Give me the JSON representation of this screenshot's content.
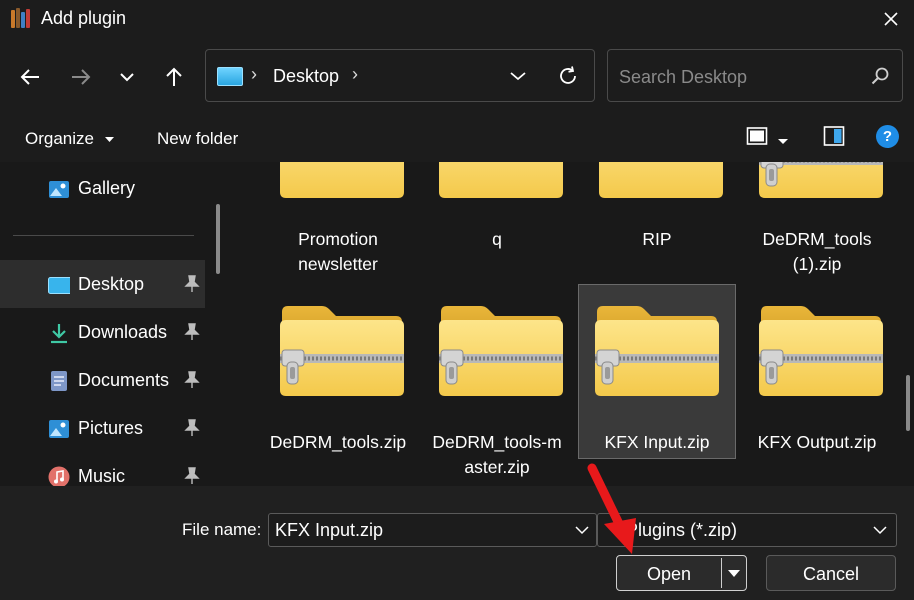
{
  "window": {
    "title": "Add plugin",
    "icons": {
      "app": "bookshelf-icon",
      "close": "close-icon"
    }
  },
  "navbar": {
    "icons": [
      "back-arrow-icon",
      "forward-arrow-icon",
      "recent-locations-chevron-icon",
      "up-arrow-icon"
    ],
    "address": {
      "folder_icon": "desktop-folder-icon",
      "separator": "›",
      "location": "Desktop",
      "trailing_separator": "›",
      "dropdown_icon": "chevron-down-icon",
      "refresh_icon": "refresh-icon"
    },
    "search": {
      "placeholder": "Search Desktop",
      "icon": "search-icon"
    }
  },
  "toolbar": {
    "organize_label": "Organize",
    "new_folder_label": "New folder",
    "view_icon": "view-mode-icon",
    "preview_icon": "preview-pane-icon",
    "help_label": "?"
  },
  "sidebar": {
    "items": [
      {
        "label": "Gallery",
        "icon": "gallery-icon",
        "pinned": false,
        "active": false
      },
      {
        "label": "Desktop",
        "icon": "desktop-folder-icon",
        "pinned": true,
        "active": true
      },
      {
        "label": "Downloads",
        "icon": "download-icon",
        "pinned": true,
        "active": false
      },
      {
        "label": "Documents",
        "icon": "documents-icon",
        "pinned": true,
        "active": false
      },
      {
        "label": "Pictures",
        "icon": "pictures-icon",
        "pinned": true,
        "active": false
      },
      {
        "label": "Music",
        "icon": "music-icon",
        "pinned": true,
        "active": false
      }
    ]
  },
  "files": {
    "row1": [
      {
        "name_line1": "Promotion",
        "name_line2": "newsletter",
        "type": "folder"
      },
      {
        "name_line1": "q",
        "name_line2": "",
        "type": "folder"
      },
      {
        "name_line1": "RIP",
        "name_line2": "",
        "type": "folder"
      },
      {
        "name_line1": "DeDRM_tools",
        "name_line2": "(1).zip",
        "type": "zip"
      }
    ],
    "row2": [
      {
        "name_line1": "DeDRM_tools.zip",
        "name_line2": "",
        "type": "zip",
        "selected": false
      },
      {
        "name_line1": "DeDRM_tools-m",
        "name_line2": "aster.zip",
        "type": "zip",
        "selected": false
      },
      {
        "name_line1": "KFX Input.zip",
        "name_line2": "",
        "type": "zip",
        "selected": true
      },
      {
        "name_line1": "KFX Output.zip",
        "name_line2": "",
        "type": "zip",
        "selected": false
      }
    ]
  },
  "bottom": {
    "file_name_label": "File name:",
    "file_name_value": "KFX Input.zip",
    "file_type_value": "Plugins (*.zip)",
    "open_label": "Open",
    "cancel_label": "Cancel"
  },
  "annotation": {
    "arrow_color": "#e8191b",
    "icon": "red-arrow-icon"
  },
  "colors": {
    "background": "#191919",
    "panel": "#1c1c1c",
    "bottom_panel": "#202020",
    "accent": "#1f8de6",
    "folder_yellow": "#f7cd4f"
  }
}
